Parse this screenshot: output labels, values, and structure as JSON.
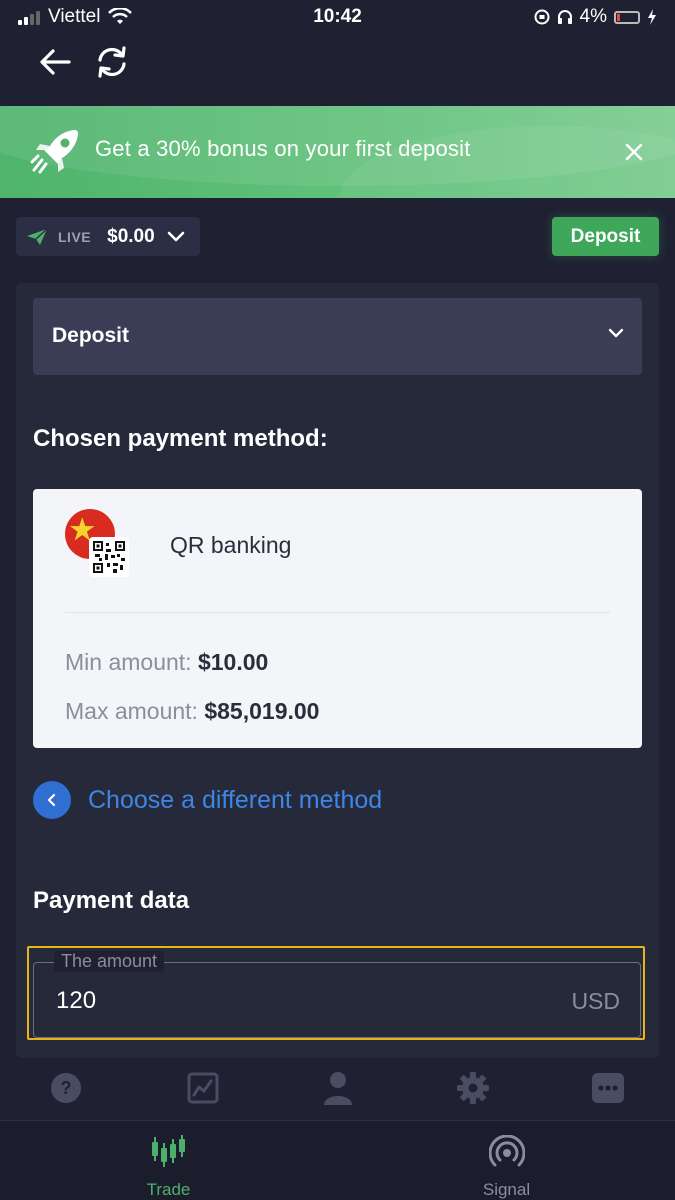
{
  "status_bar": {
    "carrier": "Viettel",
    "time": "10:42",
    "battery": "4%"
  },
  "banner": {
    "text": "Get a 30% bonus on your first deposit",
    "icon": "rocket-icon"
  },
  "account": {
    "type_label": "LIVE",
    "balance": "$0.00",
    "deposit_button": "Deposit"
  },
  "section_dropdown": {
    "label": "Deposit"
  },
  "payment_method": {
    "heading": "Chosen payment method:",
    "name": "QR banking",
    "min_label": "Min amount:",
    "min_value": "$10.00",
    "max_label": "Max amount:",
    "max_value": "$85,019.00",
    "change_link": "Choose a different method"
  },
  "payment_data": {
    "heading": "Payment data",
    "amount_legend": "The amount",
    "amount_value": "120",
    "currency": "USD"
  },
  "quick_icons": [
    "help-icon",
    "chart-icon",
    "user-icon",
    "settings-icon",
    "more-icon"
  ],
  "tabs": [
    {
      "label": "Trade",
      "icon": "candlestick-icon",
      "active": true
    },
    {
      "label": "Signal",
      "icon": "signal-icon",
      "active": false
    }
  ],
  "colors": {
    "background": "#1f2133",
    "accent_green": "#3fa75a",
    "link_blue": "#3d86e6",
    "highlight_border": "#e8b417"
  }
}
